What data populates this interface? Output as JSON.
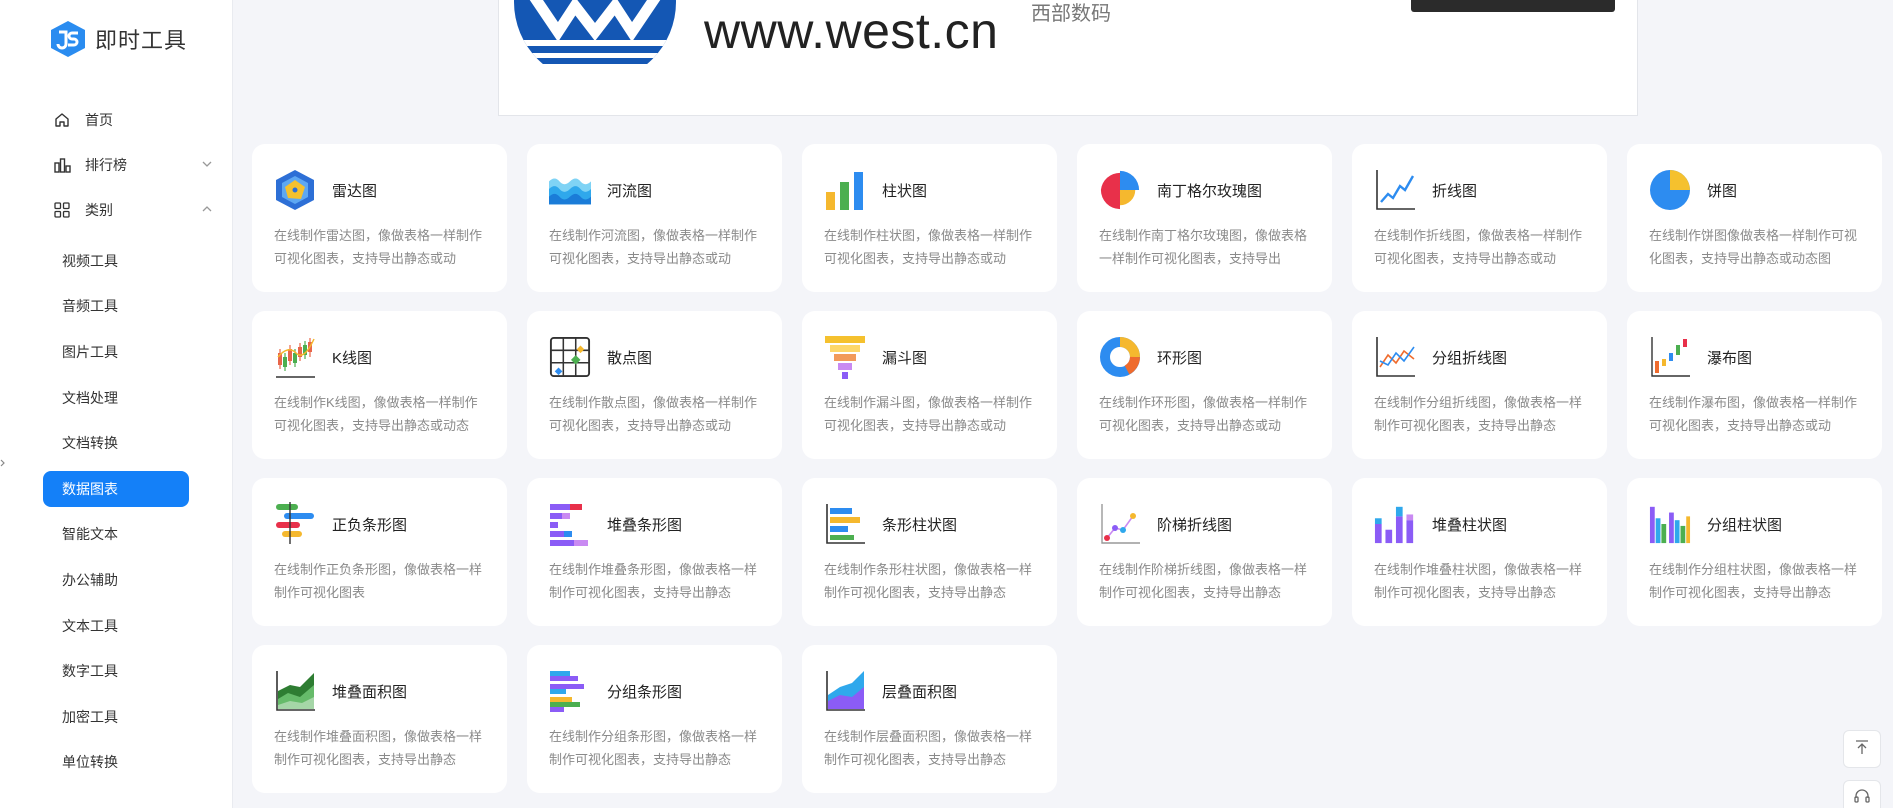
{
  "app": {
    "logo_text": "即时工具"
  },
  "nav": {
    "home": "首页",
    "ranking": "排行榜",
    "category": "类别"
  },
  "categories": [
    "视频工具",
    "音频工具",
    "图片工具",
    "文档处理",
    "文档转换",
    "数据图表",
    "智能文本",
    "办公辅助",
    "文本工具",
    "数字工具",
    "加密工具",
    "单位转换"
  ],
  "active_category": "数据图表",
  "banner": {
    "url_text": "www.west.cn",
    "sub_text": "西部数码"
  },
  "cards": [
    {
      "icon": "radar-chart-icon",
      "title": "雷达图",
      "desc": "在线制作雷达图，像做表格一样制作可视化图表，支持导出静态或动"
    },
    {
      "icon": "river-chart-icon",
      "title": "河流图",
      "desc": "在线制作河流图，像做表格一样制作可视化图表，支持导出静态或动"
    },
    {
      "icon": "bar-chart-icon",
      "title": "柱状图",
      "desc": "在线制作柱状图，像做表格一样制作可视化图表，支持导出静态或动"
    },
    {
      "icon": "nightingale-rose-icon",
      "title": "南丁格尔玫瑰图",
      "desc": "在线制作南丁格尔玫瑰图，像做表格一样制作可视化图表，支持导出"
    },
    {
      "icon": "line-chart-icon",
      "title": "折线图",
      "desc": "在线制作折线图，像做表格一样制作可视化图表，支持导出静态或动"
    },
    {
      "icon": "pie-chart-icon",
      "title": "饼图",
      "desc": "在线制作饼图像做表格一样制作可视化图表，支持导出静态或动态图"
    },
    {
      "icon": "candlestick-chart-icon",
      "title": "K线图",
      "desc": "在线制作K线图，像做表格一样制作可视化图表，支持导出静态或动态"
    },
    {
      "icon": "scatter-chart-icon",
      "title": "散点图",
      "desc": "在线制作散点图，像做表格一样制作可视化图表，支持导出静态或动"
    },
    {
      "icon": "funnel-chart-icon",
      "title": "漏斗图",
      "desc": "在线制作漏斗图，像做表格一样制作可视化图表，支持导出静态或动"
    },
    {
      "icon": "donut-chart-icon",
      "title": "环形图",
      "desc": "在线制作环形图，像做表格一样制作可视化图表，支持导出静态或动"
    },
    {
      "icon": "grouped-line-chart-icon",
      "title": "分组折线图",
      "desc": "在线制作分组折线图，像做表格一样制作可视化图表，支持导出静态"
    },
    {
      "icon": "waterfall-chart-icon",
      "title": "瀑布图",
      "desc": "在线制作瀑布图，像做表格一样制作可视化图表，支持导出静态或动"
    },
    {
      "icon": "diverging-bar-icon",
      "title": "正负条形图",
      "desc": "在线制作正负条形图，像做表格一样制作可视化图表"
    },
    {
      "icon": "stacked-bar-icon",
      "title": "堆叠条形图",
      "desc": "在线制作堆叠条形图，像做表格一样制作可视化图表，支持导出静态"
    },
    {
      "icon": "bar-column-chart-icon",
      "title": "条形柱状图",
      "desc": "在线制作条形柱状图，像做表格一样制作可视化图表，支持导出静态"
    },
    {
      "icon": "step-line-chart-icon",
      "title": "阶梯折线图",
      "desc": "在线制作阶梯折线图，像做表格一样制作可视化图表，支持导出静态"
    },
    {
      "icon": "stacked-column-icon",
      "title": "堆叠柱状图",
      "desc": "在线制作堆叠柱状图，像做表格一样制作可视化图表，支持导出静态"
    },
    {
      "icon": "grouped-column-icon",
      "title": "分组柱状图",
      "desc": "在线制作分组柱状图，像做表格一样制作可视化图表，支持导出静态"
    },
    {
      "icon": "stacked-area-icon",
      "title": "堆叠面积图",
      "desc": "在线制作堆叠面积图，像做表格一样制作可视化图表，支持导出静态"
    },
    {
      "icon": "grouped-bar-icon",
      "title": "分组条形图",
      "desc": "在线制作分组条形图，像做表格一样制作可视化图表，支持导出静态"
    },
    {
      "icon": "layered-area-icon",
      "title": "层叠面积图",
      "desc": "在线制作层叠面积图，像做表格一样制作可视化图表，支持导出静态"
    }
  ],
  "colors": {
    "accent": "#1480f8",
    "background": "#f4f5f9"
  }
}
